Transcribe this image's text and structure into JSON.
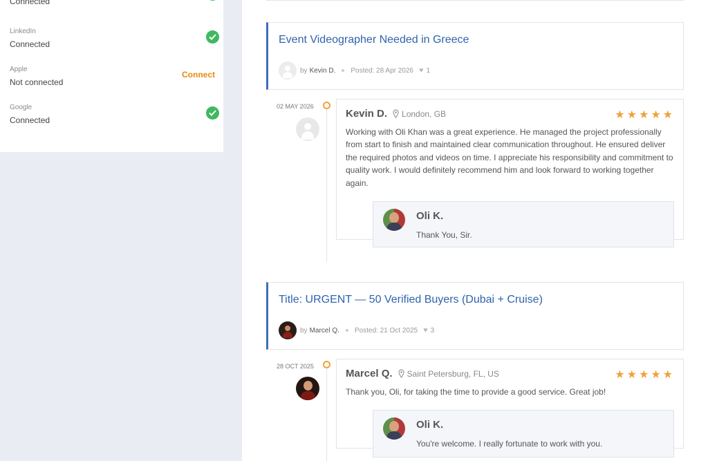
{
  "sidebar": {
    "connections": [
      {
        "name": "",
        "status": "Connected",
        "connected": true
      },
      {
        "name": "LinkedIn",
        "status": "Connected",
        "connected": true
      },
      {
        "name": "Apple",
        "status": "Not connected",
        "connected": false,
        "action": "Connect"
      },
      {
        "name": "Google",
        "status": "Connected",
        "connected": true
      }
    ]
  },
  "feedback": [
    {
      "job": {
        "title": "Event Videographer Needed in Greece",
        "by_label": "by",
        "author": "Kevin D.",
        "posted": "Posted: 28 Apr 2026",
        "likes": "1"
      },
      "date": "02 MAY 2026",
      "review": {
        "name": "Kevin D.",
        "location": "London, GB",
        "rating": 5,
        "stars": "★★★★★",
        "text": "Working with Oli Khan was a great experience. He managed the project professionally from start to finish and maintained clear communication throughout. He ensured deliver the required photos and videos on time. I appreciate his responsibility and commitment to quality work. I would definitely recommend him and look forward to working together again."
      },
      "reply": {
        "name": "Oli K.",
        "text": "Thank You, Sir."
      }
    },
    {
      "job": {
        "title": "Title: URGENT — 50 Verified Buyers (Dubai + Cruise)",
        "by_label": "by",
        "author": "Marcel Q.",
        "posted": "Posted: 21 Oct 2025",
        "likes": "3"
      },
      "date": "28 OCT 2025",
      "review": {
        "name": "Marcel Q.",
        "location": "Saint Petersburg, FL, US",
        "rating": 5,
        "stars": "★★★★★",
        "text": "Thank you, Oli, for taking the time to provide a good service. Great job!"
      },
      "reply": {
        "name": "Oli K.",
        "text": "You're welcome. I really fortunate to work with you."
      }
    }
  ],
  "colors": {
    "accent_blue": "#2f63ad",
    "connect_orange": "#e8890c",
    "check_green": "#3fb95f",
    "star_orange": "#f0a13b"
  }
}
